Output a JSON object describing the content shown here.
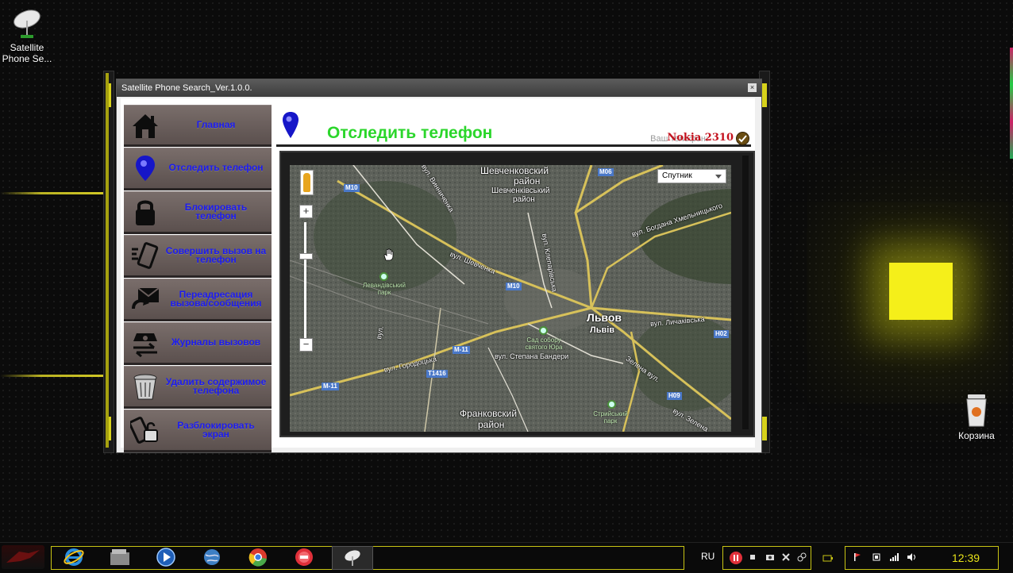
{
  "desktop": {
    "icons": [
      {
        "label": "Satellite Phone Se...",
        "icon": "satellite-dish-icon"
      },
      {
        "label": "Корзина",
        "icon": "recycle-bin-icon"
      }
    ]
  },
  "window": {
    "title": "Satellite Phone Search_Ver.1.0.0.",
    "close_label": "×"
  },
  "sidebar": {
    "items": [
      {
        "label": "Главная",
        "icon": "home-icon"
      },
      {
        "label": "Отследить телефон",
        "icon": "location-pin-icon"
      },
      {
        "label": "Блокировать телефон",
        "icon": "padlock-icon"
      },
      {
        "label": "Совершить вызов на телефон",
        "icon": "phone-call-icon"
      },
      {
        "label": "Переадресация вызова/сообщения",
        "icon": "forward-mail-icon"
      },
      {
        "label": "Журналы вызовов",
        "icon": "call-log-icon"
      },
      {
        "label": "Удалить содержимое телефона",
        "icon": "trash-icon"
      },
      {
        "label": "Разблокировать экран",
        "icon": "unlock-phone-icon"
      }
    ]
  },
  "header": {
    "title": "Отследить телефон",
    "phone_label": "Ваш телефон:",
    "phone_model": "Nokia 2310",
    "title_color": "#2bd62b",
    "model_color": "#c4121e"
  },
  "map": {
    "map_type": "Спутник",
    "zoom_in": "+",
    "zoom_out": "−",
    "labels": {
      "shevchenko_ru": "Шевченковский",
      "shevchenko_ru2": "район",
      "shevchenko_ua": "Шевченківський",
      "shevchenko_ua2": "район",
      "city_ru": "Львов",
      "city_ua": "Львів",
      "frankovsky": "Франковский",
      "frankovsky2": "район",
      "vynnychenka": "вул. Винниченка",
      "shevchenka": "вул. Шевченка",
      "khmelnytskoho": "вул. Богдана Хмельницького",
      "klepar": "вул. Клепарівська",
      "lychakivska": "вул. Личаківська",
      "horodotska": "вул. Городоцька",
      "bandery": "вул. Степана Бандери",
      "zelena": "Зелена вул.",
      "zelena2": "вул. Зелена",
      "syhiv": "вул. Сихівська",
      "kulparkivska": "вул. Кульпарківська",
      "levandivsky": "Левандівський парк",
      "sad_yura": "Сад собору святого Юра",
      "stryisky": "Стрийський парк",
      "vul": "вул."
    },
    "roads": [
      "M10",
      "M06",
      "M10",
      "M-11",
      "T1416",
      "M-11",
      "H02",
      "H09"
    ]
  },
  "taskbar": {
    "language": "RU",
    "clock": "12:39",
    "accent": "#c8c414"
  }
}
